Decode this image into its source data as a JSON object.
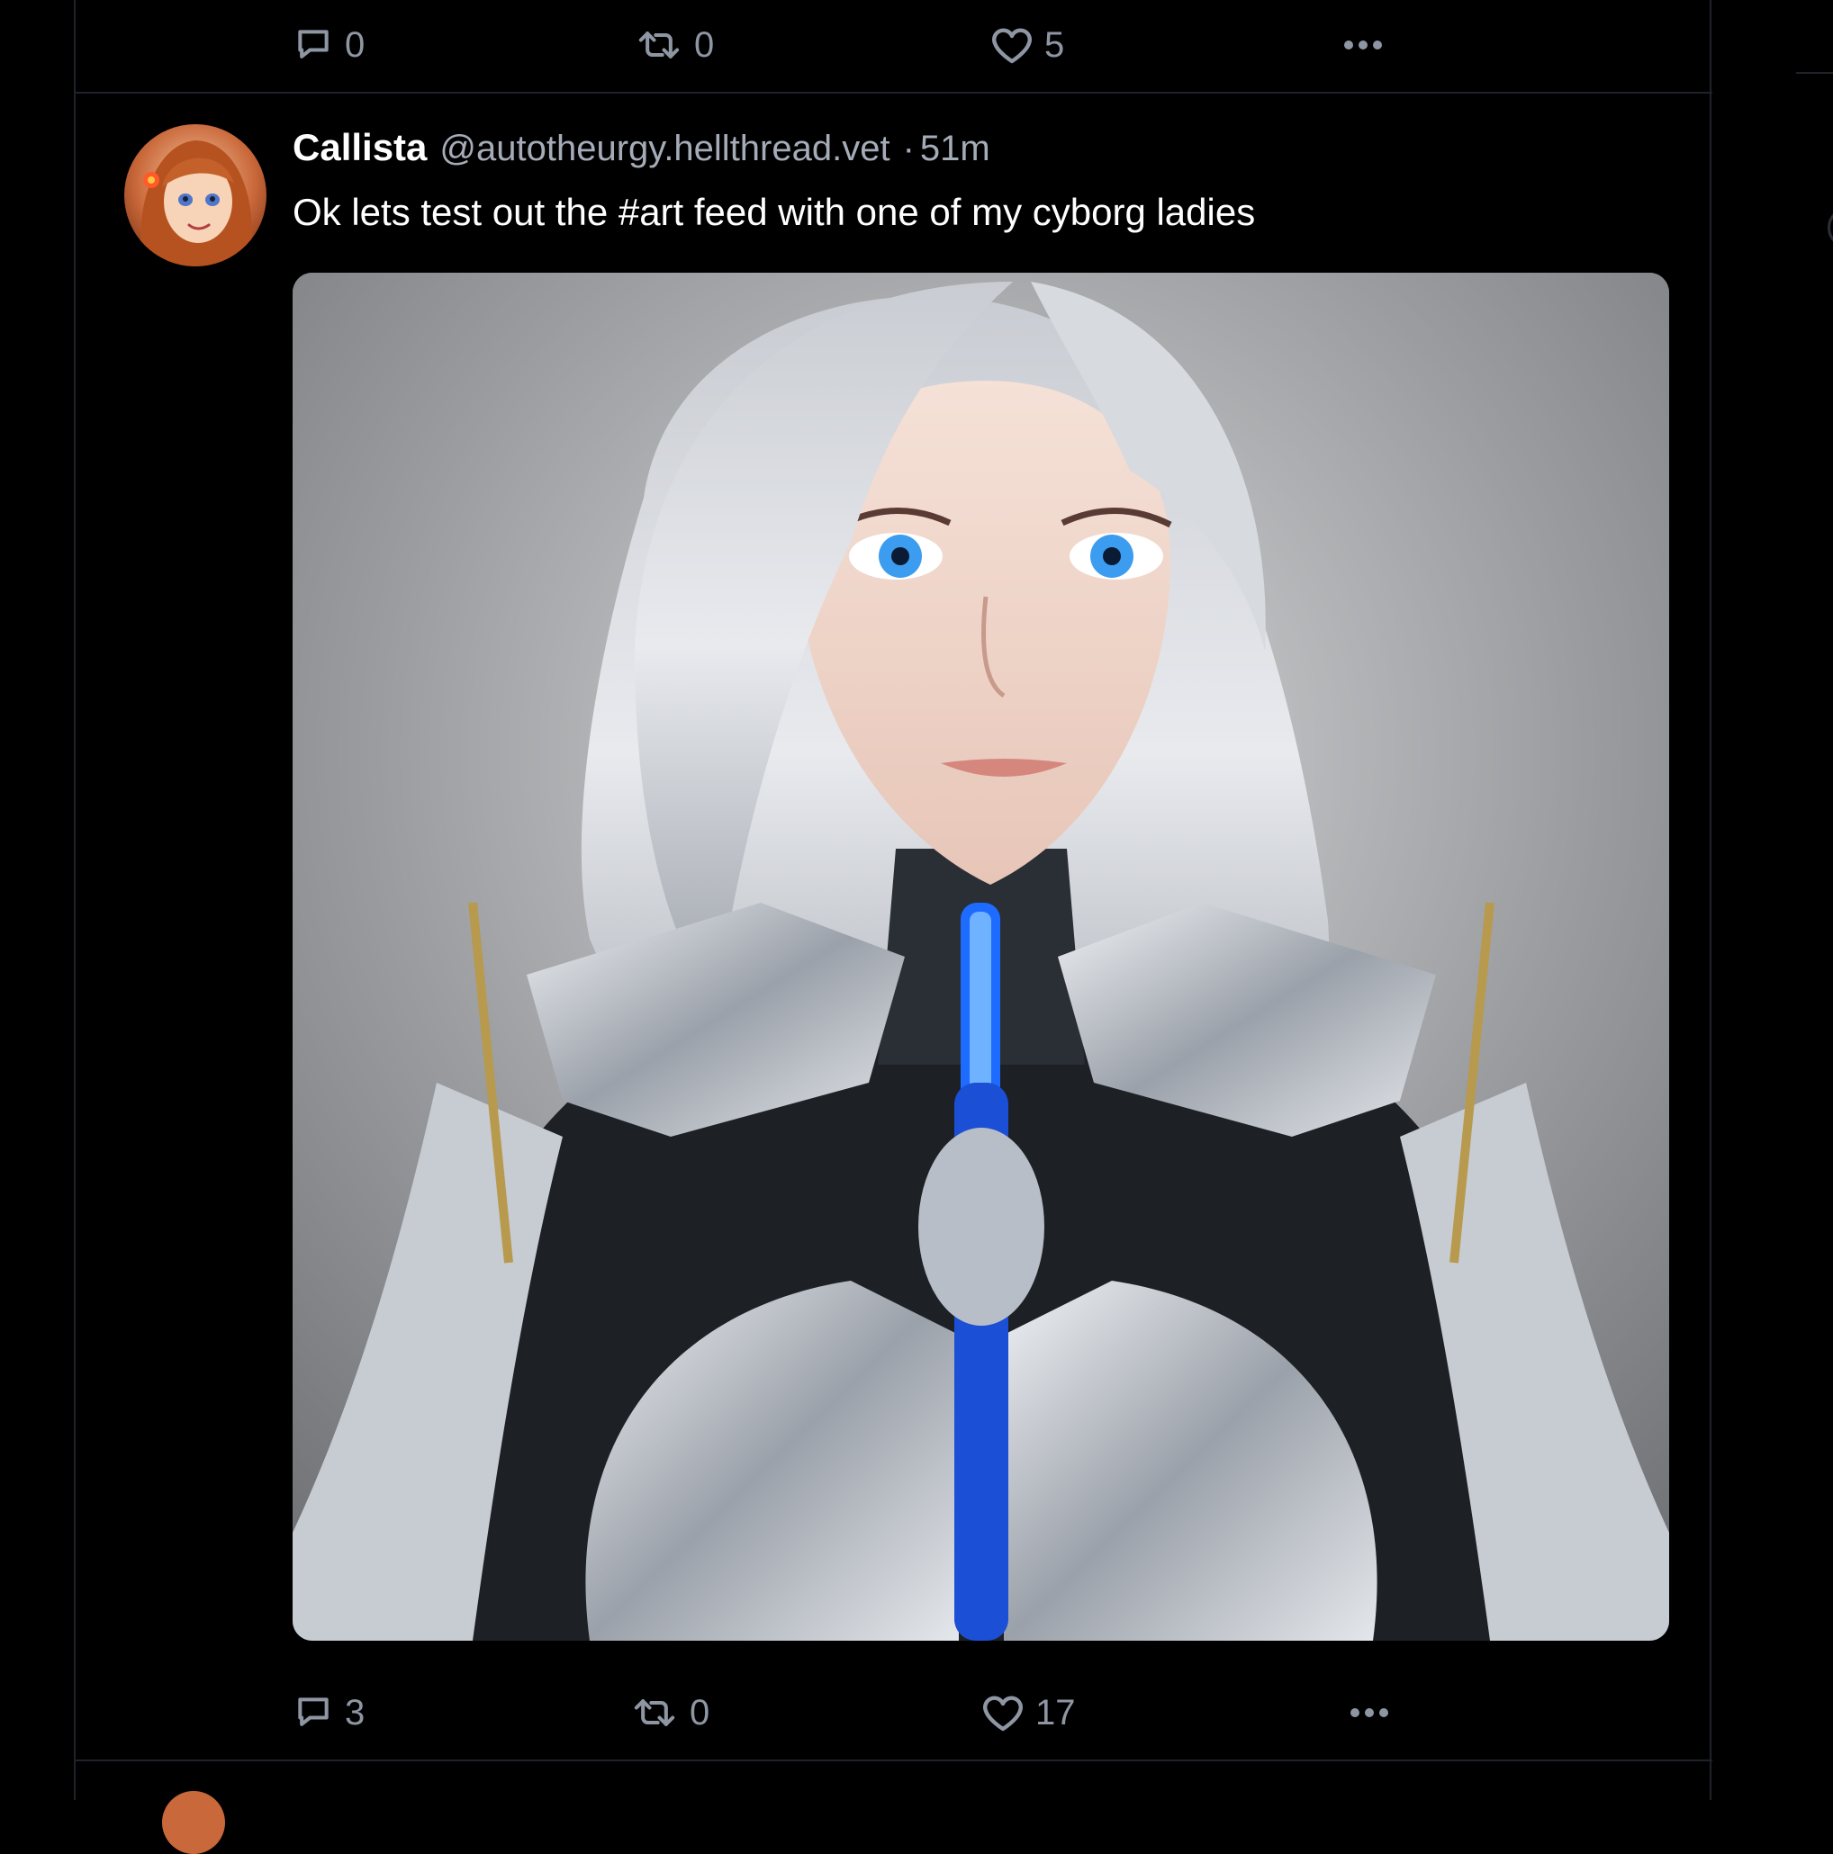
{
  "previous_post": {
    "reply_count": "0",
    "repost_count": "0",
    "like_count": "5"
  },
  "post": {
    "author_name": "Callista",
    "author_handle": "@autotheurgy.hellthread.vet",
    "separator": "·",
    "time": "51m",
    "text": "Ok lets test out the #art feed with one of my cyborg ladies",
    "reply_count": "3",
    "repost_count": "0",
    "like_count": "17"
  },
  "colors": {
    "background": "#000000",
    "divider": "#1f2329",
    "muted_text": "#8f96a3"
  }
}
